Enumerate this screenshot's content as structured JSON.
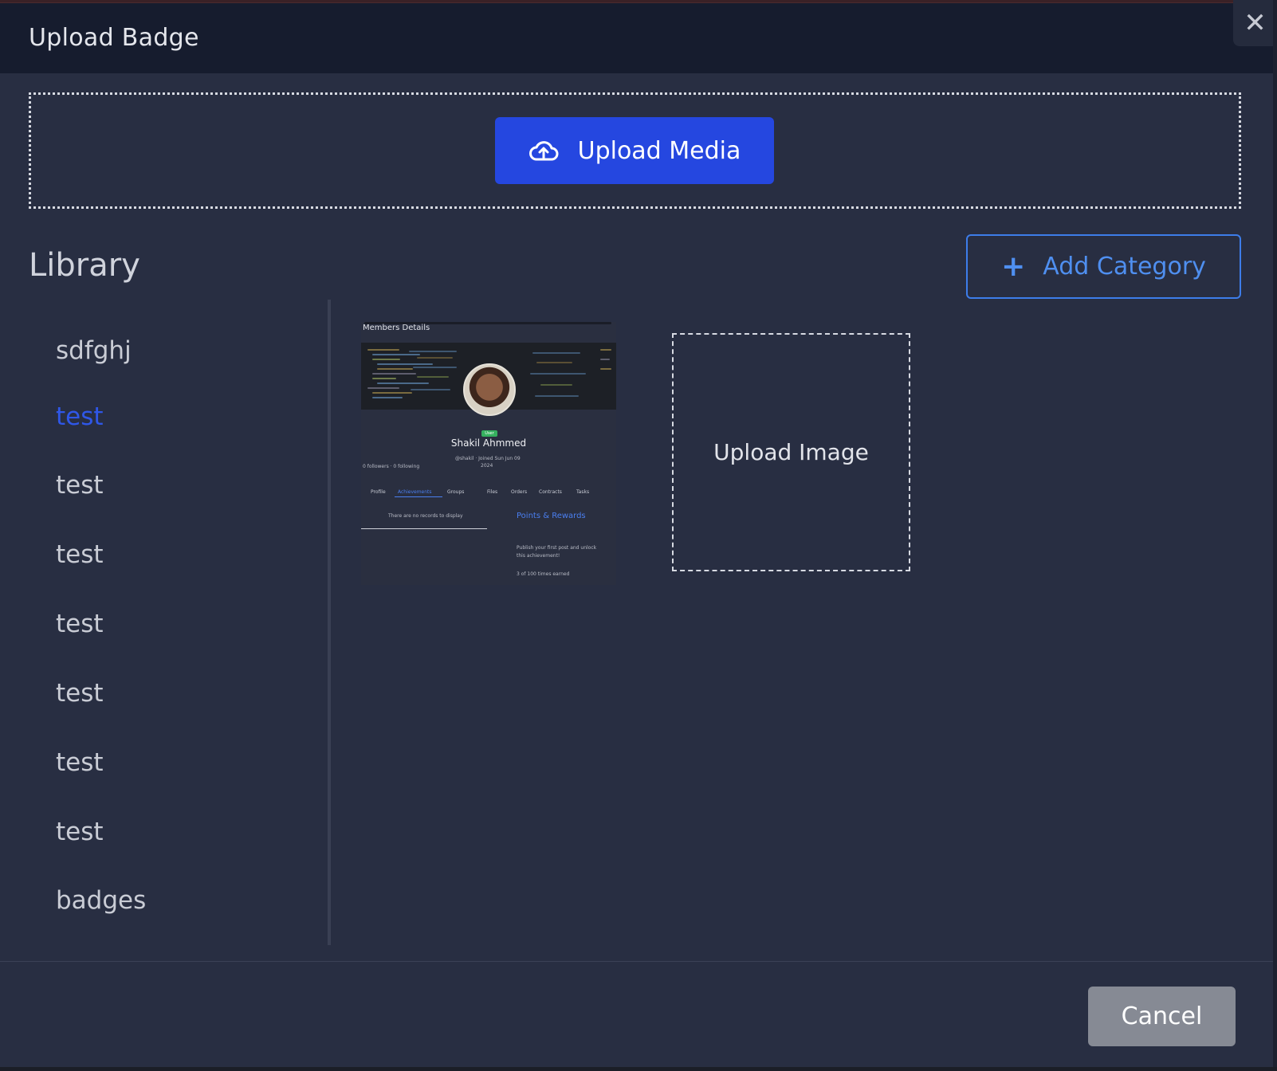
{
  "dialog": {
    "title": "Upload Badge",
    "close_icon": "close-icon"
  },
  "upload": {
    "button_label": "Upload Media",
    "icon": "cloud-upload-icon"
  },
  "library": {
    "title": "Library",
    "add_category_label": "Add Category",
    "add_icon": "plus-icon",
    "active_index": 1,
    "categories": [
      {
        "label": "sdfghj"
      },
      {
        "label": "test"
      },
      {
        "label": "test"
      },
      {
        "label": "test"
      },
      {
        "label": "test"
      },
      {
        "label": "test"
      },
      {
        "label": "test"
      },
      {
        "label": "test"
      },
      {
        "label": "badges"
      }
    ]
  },
  "thumbnail": {
    "header": "Members Details",
    "name": "Shakil Ahmmed",
    "role_badge": "User",
    "handle": "@shakil · Joined Sun Jun 09",
    "year": "2024",
    "follow_stats": "0 followers · 0 following",
    "tabs": [
      "Profile",
      "Achievements",
      "Groups",
      "Files",
      "Orders",
      "Contracts",
      "Tasks"
    ],
    "active_tab": "Achievements",
    "empty_text": "There are no records to display",
    "section_title": "Points & Rewards",
    "desc_line1": "Publish your first post and unlock",
    "desc_line2": "this achievement!",
    "earned_text": "3 of 100 times earned"
  },
  "upload_image_label": "Upload Image",
  "footer": {
    "cancel_label": "Cancel"
  },
  "colors": {
    "accent": "#2547e0",
    "link": "#4f8ff0",
    "active_category": "#2f57e8",
    "modal_bg": "#282e42",
    "header_bg": "#161c2e"
  }
}
